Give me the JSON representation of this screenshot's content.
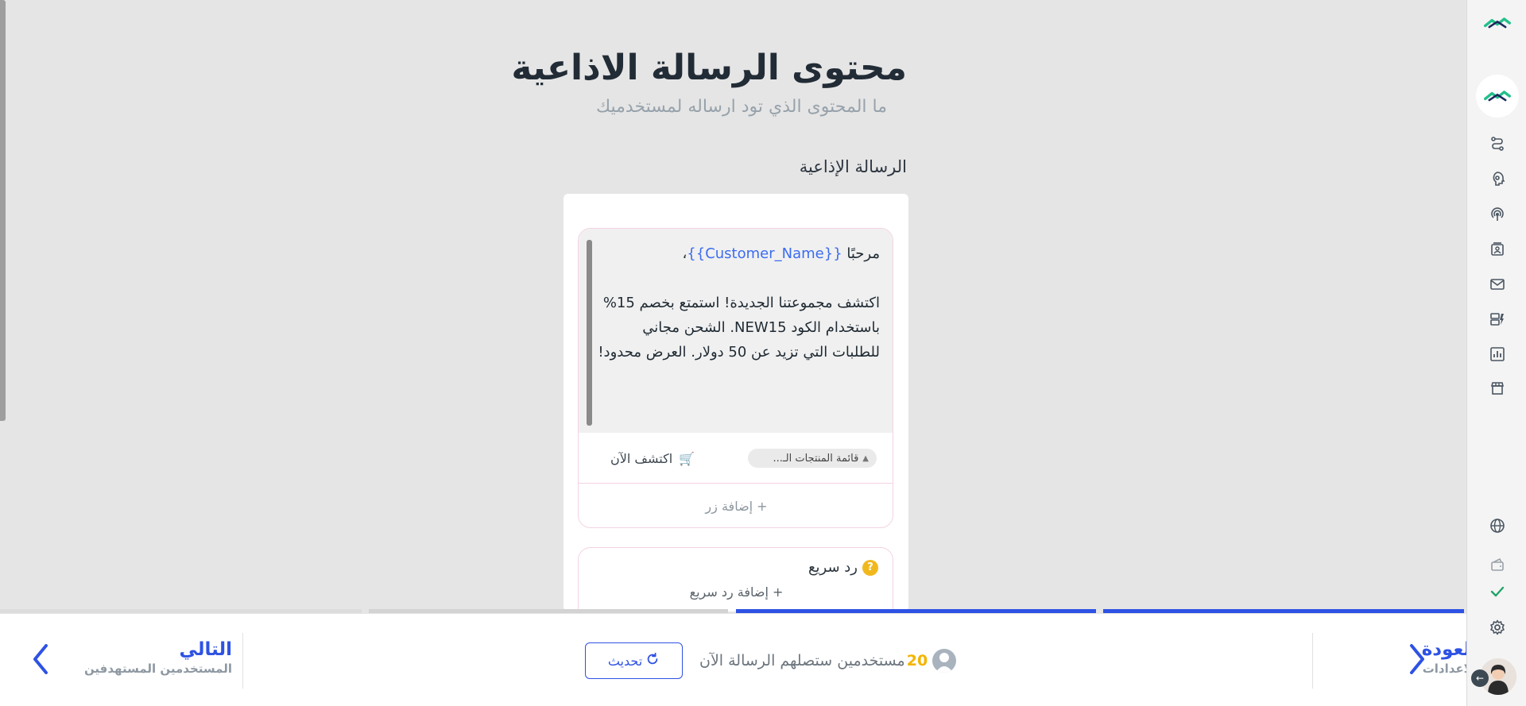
{
  "header": {
    "title": "محتوى الرسالة الاذاعية",
    "subtitle": "ما المحتوى الذي تود ارساله لمستخدميك"
  },
  "broadcast": {
    "section_label": "الرسالة الإذاعية",
    "greeting_prefix": "مرحبًا ",
    "greeting_variable": "{{Customer_Name}}",
    "greeting_suffix": "،",
    "body_text": "اكتشف مجموعتنا الجديدة! استمتع بخصم 15% باستخدام الكود NEW15. الشحن مجاني للطلبات التي تزيد عن 50 دولار. العرض محدود!",
    "product_list_chip": "قائمة المنتجات الـ...",
    "explore_button": "اكتشف الآن",
    "explore_emoji": "🛒",
    "add_button": "+ إضافة زر"
  },
  "quick_reply": {
    "title": "رد سريع",
    "help_icon": "?",
    "add_label": "+ إضافة رد سريع"
  },
  "footer": {
    "next_title": "التالي",
    "next_subtitle": "المستخدمين المستهدفين",
    "refresh_label": "تحديث",
    "users_count": "20",
    "users_text": "مستخدمين ستصلهم الرسالة الآن",
    "back_title": "العودة",
    "back_subtitle": "الاعدادات"
  },
  "progress": {
    "steps_total": 4,
    "steps_completed": 2
  },
  "colors": {
    "accent": "#2e52e4",
    "brand_green": "#22c08a",
    "brand_navy": "#1b2a5c",
    "warning": "#f4b400",
    "check": "#22a36a"
  },
  "sidebar": {
    "icons": [
      "logo-icon",
      "brand-avatar-icon",
      "flows-icon",
      "ai-bot-icon",
      "broadcast-icon",
      "contacts-icon",
      "mail-icon",
      "templates-icon",
      "analytics-icon",
      "store-icon",
      "globe-icon",
      "wallet-icon",
      "check-icon",
      "settings-icon",
      "user-avatar-icon"
    ]
  }
}
